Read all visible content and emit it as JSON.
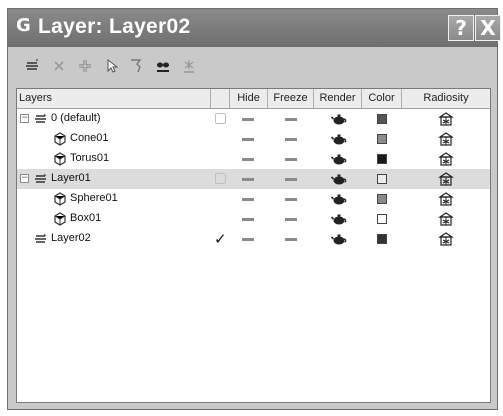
{
  "window": {
    "title": "Layer: Layer02",
    "help_label": "?",
    "close_label": "X",
    "app_icon_glyph": "G"
  },
  "toolbar": {
    "tools": [
      {
        "name": "create-layer-icon"
      },
      {
        "name": "delete-layer-icon"
      },
      {
        "name": "add-to-layer-icon"
      },
      {
        "name": "select-objects-icon"
      },
      {
        "name": "highlight-selected-icon"
      },
      {
        "name": "hide-all-icon"
      },
      {
        "name": "freeze-all-icon"
      }
    ]
  },
  "columns": {
    "layers": "Layers",
    "hide": "Hide",
    "freeze": "Freeze",
    "render": "Render",
    "color": "Color",
    "radiosity": "Radiosity"
  },
  "rows": [
    {
      "label": "0 (default)",
      "kind": "layer",
      "expanded": true,
      "current": false,
      "selected": false,
      "color": "#555555"
    },
    {
      "label": "Cone01",
      "kind": "object",
      "color": "#8c8c8c"
    },
    {
      "label": "Torus01",
      "kind": "object",
      "color": "#1a1a1a"
    },
    {
      "label": "Layer01",
      "kind": "layer",
      "expanded": true,
      "current": false,
      "selected": true,
      "color": "#ececec"
    },
    {
      "label": "Sphere01",
      "kind": "object",
      "color": "#8a8a8a"
    },
    {
      "label": "Box01",
      "kind": "object",
      "color": "#ffffff"
    },
    {
      "label": "Layer02",
      "kind": "layer",
      "expanded": false,
      "current": true,
      "selected": false,
      "color": "#333333"
    }
  ],
  "toggle_glyph": "−",
  "check_glyph": "✓"
}
